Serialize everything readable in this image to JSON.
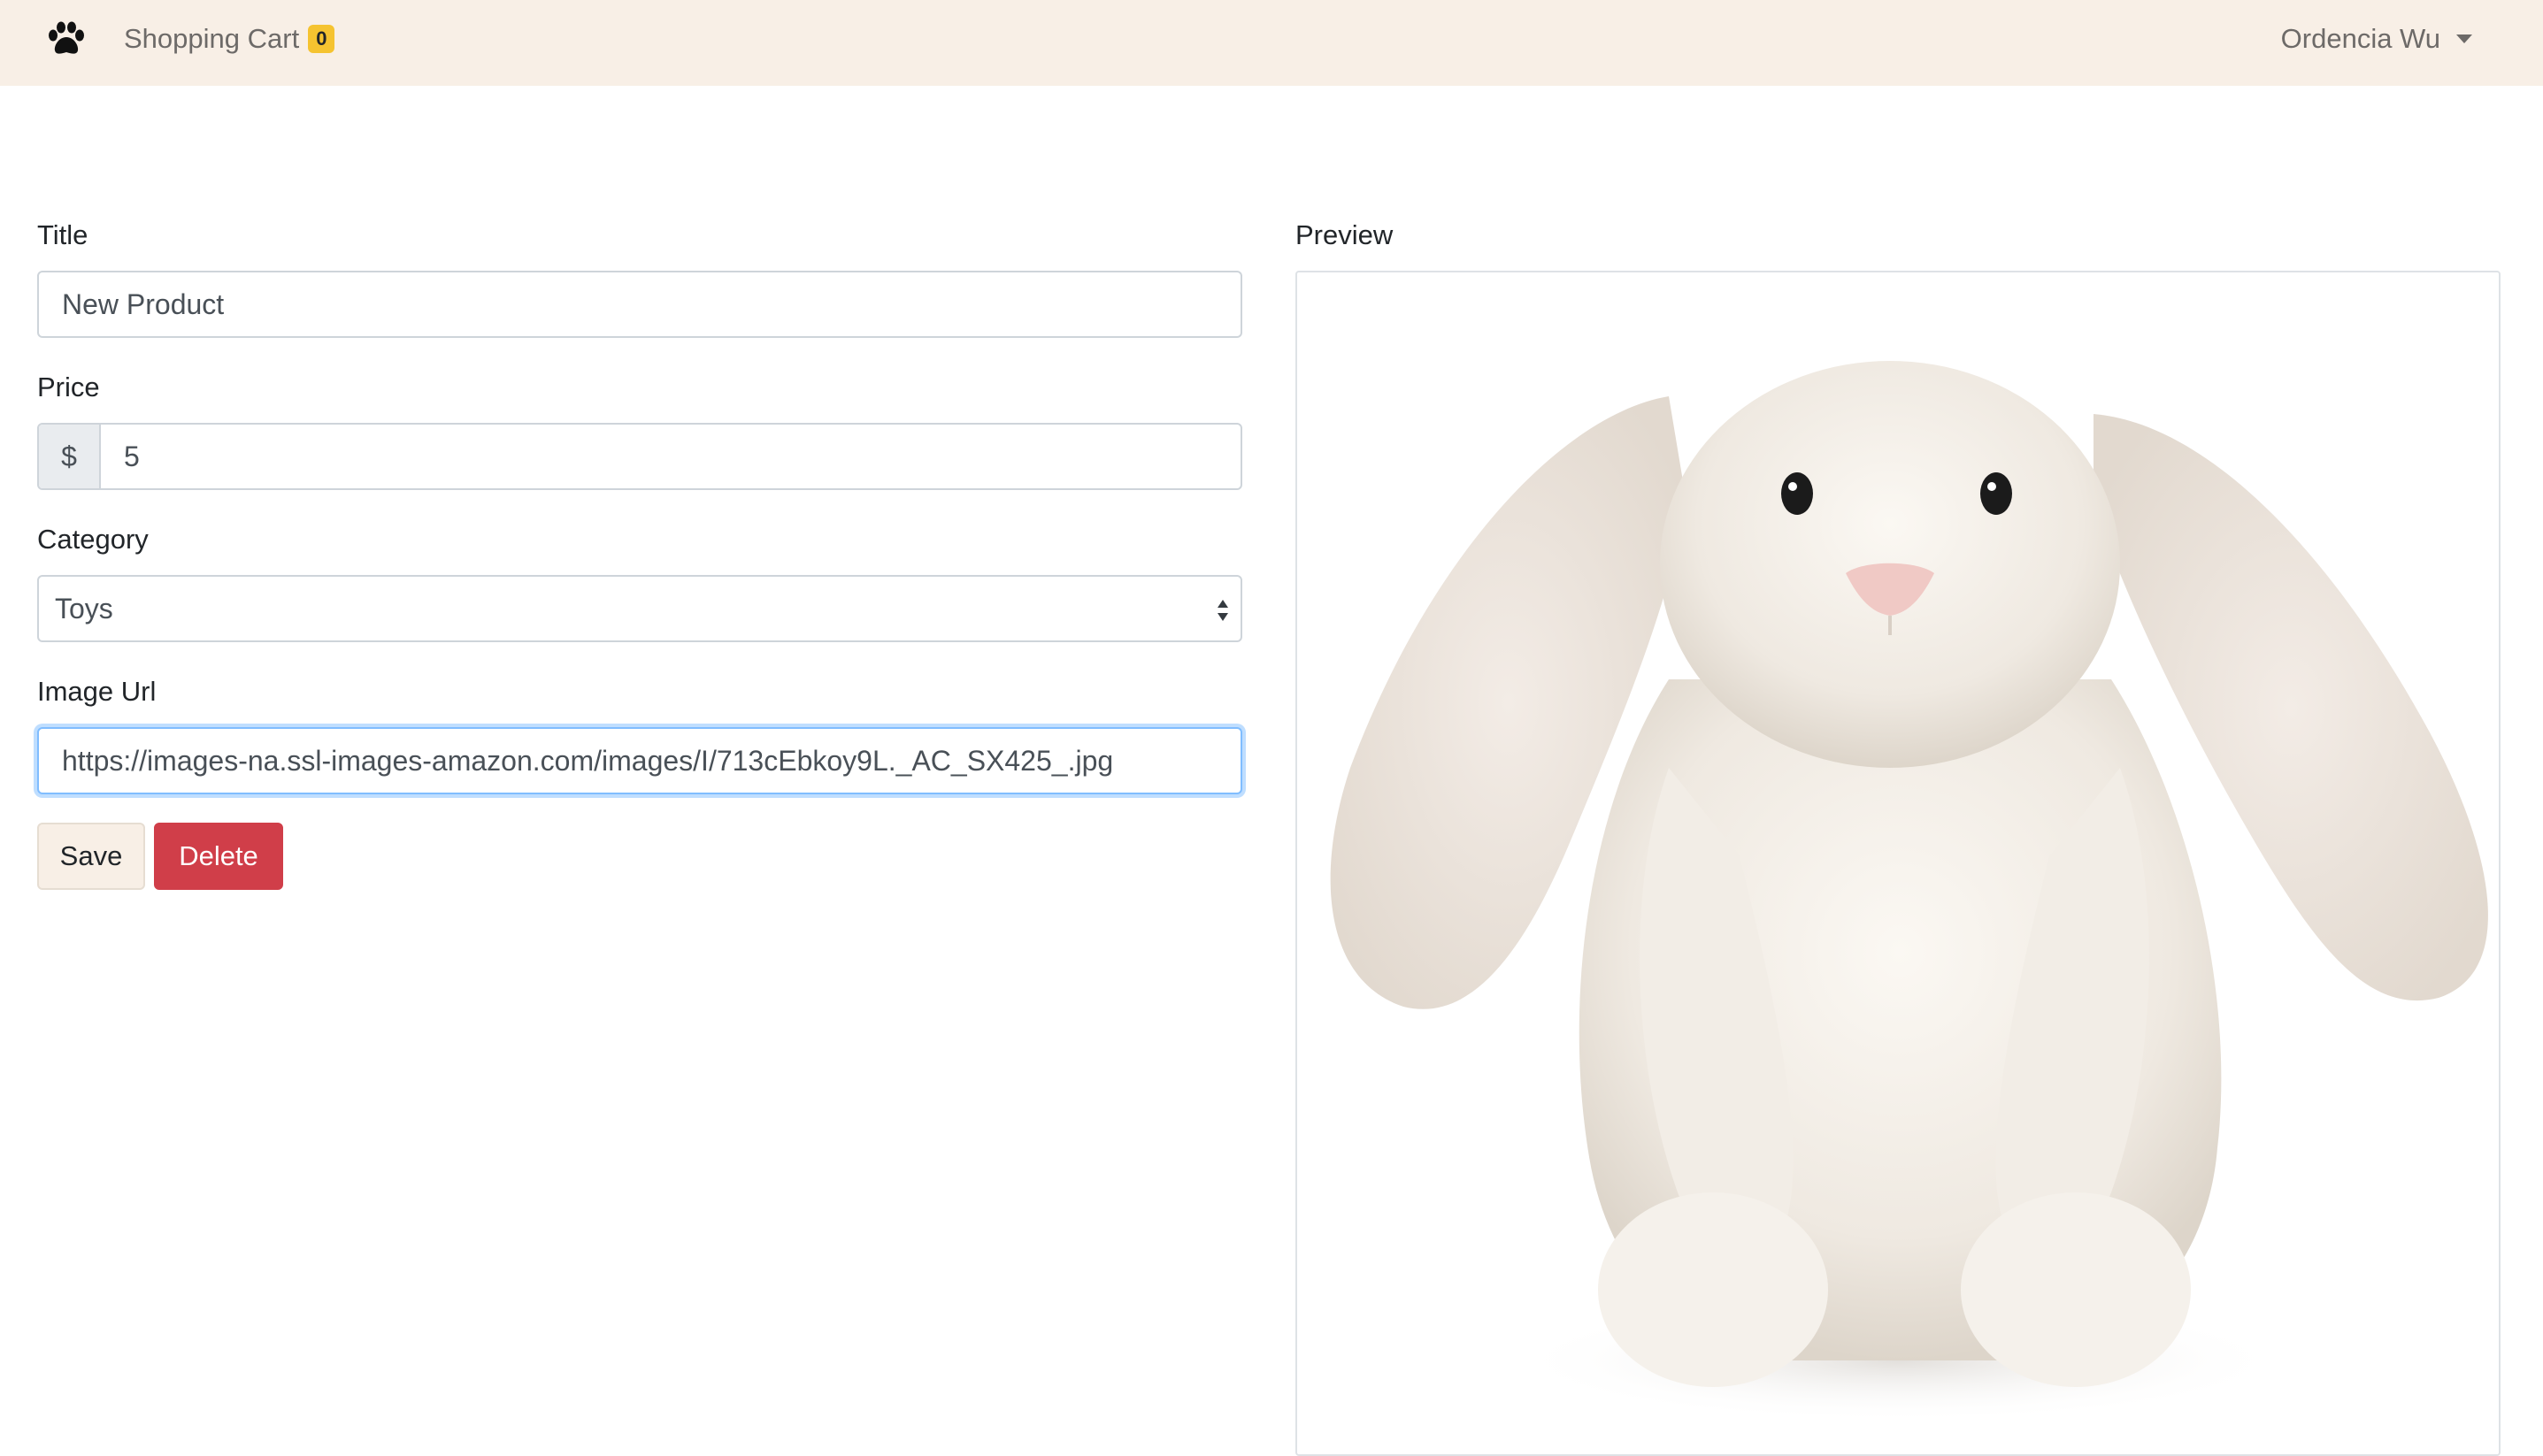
{
  "navbar": {
    "brand_icon": "paw-icon",
    "cart_label": "Shopping Cart",
    "cart_count": "0",
    "user_name": "Ordencia Wu",
    "user_menu_icon": "caret-down-icon",
    "background_color": "#f8efe6",
    "badge_color": "#f5c330"
  },
  "form": {
    "title": {
      "label": "Title",
      "value": "New Product"
    },
    "price": {
      "label": "Price",
      "prefix": "$",
      "value": "5"
    },
    "category": {
      "label": "Category",
      "value": "Toys"
    },
    "image_url": {
      "label": "Image Url",
      "value": "https://images-na.ssl-images-amazon.com/images/I/713cEbkoy9L._AC_SX425_.jpg"
    },
    "save_label": "Save",
    "delete_label": "Delete",
    "delete_color": "#d03e49"
  },
  "preview": {
    "label": "Preview",
    "image_subject": "white-plush-bunny"
  }
}
